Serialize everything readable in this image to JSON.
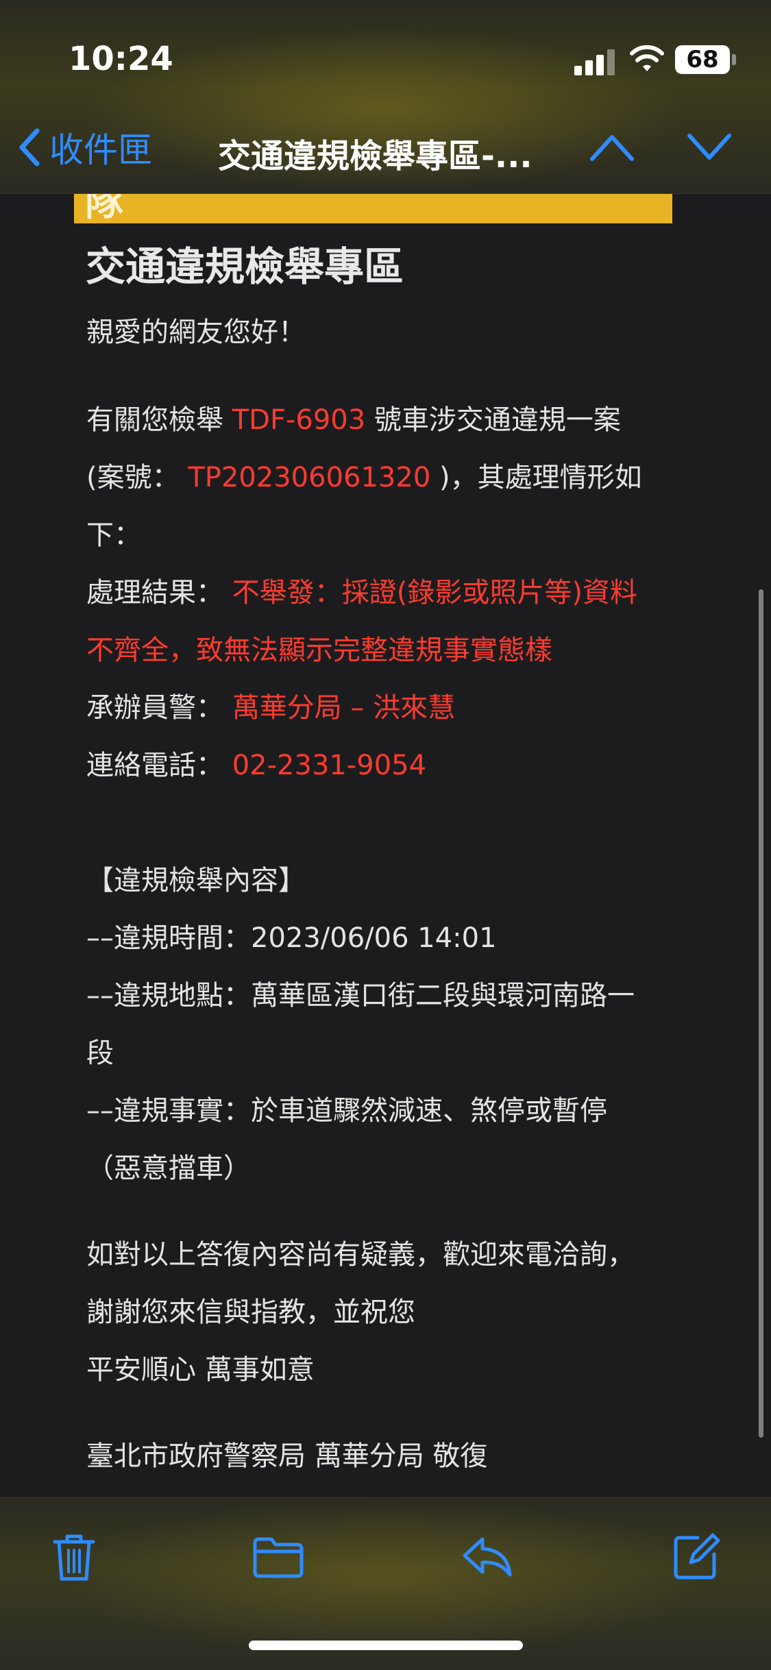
{
  "status_bar": {
    "time": "10:24",
    "battery": "68"
  },
  "nav": {
    "back_label": "收件匣",
    "title": "交通違規檢舉專區-..."
  },
  "email": {
    "banner_text": "隊",
    "heading": "交通違規檢舉專區",
    "greeting": "親愛的網友您好！",
    "p1_prefix": "有關您檢舉 ",
    "plate": "TDF-6903",
    "p1_suffix": " 號車涉交通違規一案",
    "p2_prefix": "(案號： ",
    "case_no": "TP202306061320",
    "p2_suffix": " )，其處理情形如",
    "p3": "下：",
    "result_label": "處理結果： ",
    "result_line1": "不舉發：採證(錄影或照片等)資料",
    "result_line2": "不齊全，致無法顯示完整違規事實態樣",
    "officer_label": "承辦員警： ",
    "officer": "萬華分局 – 洪來慧",
    "phone_label": "連絡電話： ",
    "phone": "02-2331-9054",
    "section_title": "【違規檢舉內容】",
    "time_line": "––違規時間：2023/06/06 14:01",
    "place_line1": "––違規地點：萬華區漢口街二段與環河南路一",
    "place_line2": "段",
    "fact_line1": "––違規事實：於車道驟然減速、煞停或暫停",
    "fact_line2": "（惡意擋車）",
    "closing1": "如對以上答復內容尚有疑義，歡迎來電洽詢，",
    "closing2": "謝謝您來信與指教，並祝您",
    "closing3": "平安順心 萬事如意",
    "signature": "臺北市政府警察局 萬華分局 敬復"
  },
  "toolbar": {
    "icons": [
      "trash-icon",
      "folder-icon",
      "reply-icon",
      "compose-icon"
    ]
  },
  "colors": {
    "accent": "#2f8cff",
    "highlight": "#ff3b30",
    "banner": "#e8b425"
  }
}
